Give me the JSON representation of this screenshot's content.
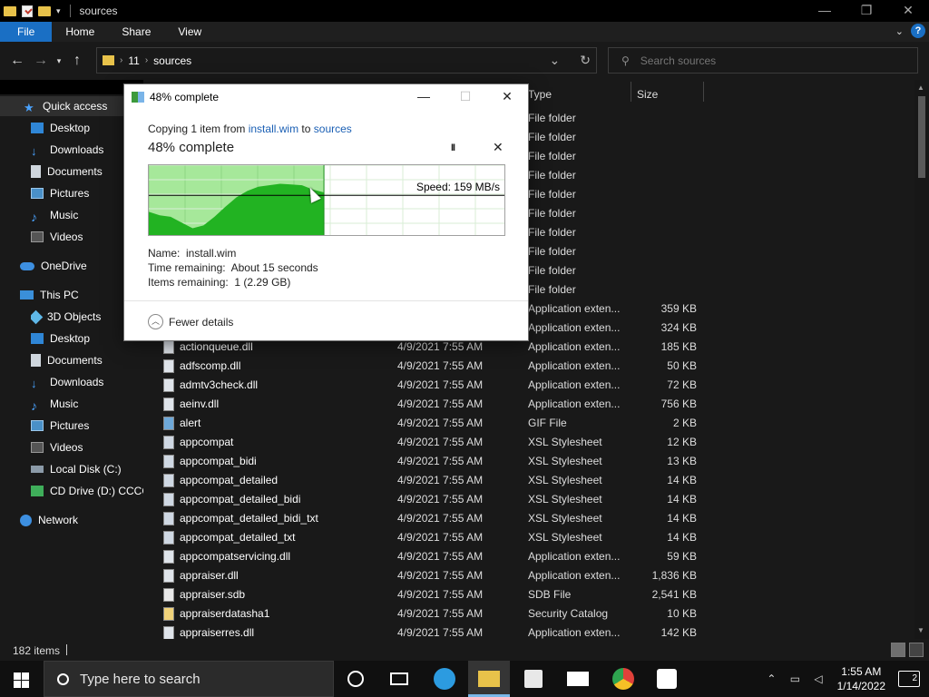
{
  "window": {
    "title": "sources",
    "controls": [
      "—",
      "❐",
      "✕"
    ]
  },
  "ribbon": {
    "tabs": [
      "File",
      "Home",
      "Share",
      "View"
    ],
    "help": "?"
  },
  "address": {
    "crumbs": [
      "11",
      "sources"
    ]
  },
  "search": {
    "placeholder": "Search sources"
  },
  "nav": {
    "items": [
      {
        "label": "Quick access",
        "icon": "star-icon"
      },
      {
        "label": "Desktop",
        "icon": "desktop-icon"
      },
      {
        "label": "Downloads",
        "icon": "download-icon"
      },
      {
        "label": "Documents",
        "icon": "document-icon"
      },
      {
        "label": "Pictures",
        "icon": "pictures-icon"
      },
      {
        "label": "Music",
        "icon": "music-icon"
      },
      {
        "label": "Videos",
        "icon": "videos-icon"
      },
      {
        "label": "OneDrive",
        "icon": "cloud-icon"
      },
      {
        "label": "This PC",
        "icon": "pc-icon"
      },
      {
        "label": "3D Objects",
        "icon": "cube-icon"
      },
      {
        "label": "Desktop",
        "icon": "desktop-icon"
      },
      {
        "label": "Documents",
        "icon": "document-icon"
      },
      {
        "label": "Downloads",
        "icon": "download-icon"
      },
      {
        "label": "Music",
        "icon": "music-icon"
      },
      {
        "label": "Pictures",
        "icon": "pictures-icon"
      },
      {
        "label": "Videos",
        "icon": "videos-icon"
      },
      {
        "label": "Local Disk (C:)",
        "icon": "disk-icon"
      },
      {
        "label": "CD Drive (D:) CCCO",
        "icon": "cd-drive-icon"
      },
      {
        "label": "Network",
        "icon": "network-icon"
      }
    ]
  },
  "columns": {
    "type": "Type",
    "size": "Size"
  },
  "folder_rows": {
    "type": "File folder",
    "count": 10
  },
  "files": [
    {
      "name": "",
      "date": "",
      "type": "Application exten...",
      "size": "359 KB",
      "icon": "dll"
    },
    {
      "name": "",
      "date": "",
      "type": "Application exten...",
      "size": "324 KB",
      "icon": "dll"
    },
    {
      "name": "actionqueue.dll",
      "date": "4/9/2021 7:55 AM",
      "type": "Application exten...",
      "size": "185 KB",
      "icon": "dll"
    },
    {
      "name": "adfscomp.dll",
      "date": "4/9/2021 7:55 AM",
      "type": "Application exten...",
      "size": "50 KB",
      "icon": "dll"
    },
    {
      "name": "admtv3check.dll",
      "date": "4/9/2021 7:55 AM",
      "type": "Application exten...",
      "size": "72 KB",
      "icon": "dll"
    },
    {
      "name": "aeinv.dll",
      "date": "4/9/2021 7:55 AM",
      "type": "Application exten...",
      "size": "756 KB",
      "icon": "dll"
    },
    {
      "name": "alert",
      "date": "4/9/2021 7:55 AM",
      "type": "GIF File",
      "size": "2 KB",
      "icon": "gif"
    },
    {
      "name": "appcompat",
      "date": "4/9/2021 7:55 AM",
      "type": "XSL Stylesheet",
      "size": "12 KB",
      "icon": "xsl"
    },
    {
      "name": "appcompat_bidi",
      "date": "4/9/2021 7:55 AM",
      "type": "XSL Stylesheet",
      "size": "13 KB",
      "icon": "xsl"
    },
    {
      "name": "appcompat_detailed",
      "date": "4/9/2021 7:55 AM",
      "type": "XSL Stylesheet",
      "size": "14 KB",
      "icon": "xsl"
    },
    {
      "name": "appcompat_detailed_bidi",
      "date": "4/9/2021 7:55 AM",
      "type": "XSL Stylesheet",
      "size": "14 KB",
      "icon": "xsl"
    },
    {
      "name": "appcompat_detailed_bidi_txt",
      "date": "4/9/2021 7:55 AM",
      "type": "XSL Stylesheet",
      "size": "14 KB",
      "icon": "xsl"
    },
    {
      "name": "appcompat_detailed_txt",
      "date": "4/9/2021 7:55 AM",
      "type": "XSL Stylesheet",
      "size": "14 KB",
      "icon": "xsl"
    },
    {
      "name": "appcompatservicing.dll",
      "date": "4/9/2021 7:55 AM",
      "type": "Application exten...",
      "size": "59 KB",
      "icon": "dll"
    },
    {
      "name": "appraiser.dll",
      "date": "4/9/2021 7:55 AM",
      "type": "Application exten...",
      "size": "1,836 KB",
      "icon": "dll"
    },
    {
      "name": "appraiser.sdb",
      "date": "4/9/2021 7:55 AM",
      "type": "SDB File",
      "size": "2,541 KB",
      "icon": "sdb"
    },
    {
      "name": "appraiserdatasha1",
      "date": "4/9/2021 7:55 AM",
      "type": "Security Catalog",
      "size": "10 KB",
      "icon": "cat"
    },
    {
      "name": "appraiserres.dll",
      "date": "4/9/2021 7:55 AM",
      "type": "Application exten...",
      "size": "142 KB",
      "icon": "dll"
    }
  ],
  "status": {
    "count": "182 items"
  },
  "dialog": {
    "title": "48% complete",
    "copy_prefix": "Copying 1 item from",
    "source": "install.wim",
    "to_word": "to",
    "dest": "sources",
    "heading": "48% complete",
    "pause": "II",
    "cancel": "✕",
    "speed": "Speed: 159 MB/s",
    "progress": 0.49,
    "speed_profile": [
      0.35,
      0.3,
      0.28,
      0.2,
      0.12,
      0.16,
      0.28,
      0.42,
      0.55,
      0.64,
      0.7,
      0.72,
      0.74,
      0.73,
      0.72,
      0.66,
      0.62
    ],
    "name_label": "Name:",
    "name_value": "install.wim",
    "time_label": "Time remaining:",
    "time_value": "About 15 seconds",
    "items_label": "Items remaining:",
    "items_value": "1 (2.29 GB)",
    "fewer_details": "Fewer details"
  },
  "taskbar": {
    "search_placeholder": "Type here to search",
    "time": "1:55 AM",
    "date": "1/14/2022",
    "notifications": "2"
  }
}
